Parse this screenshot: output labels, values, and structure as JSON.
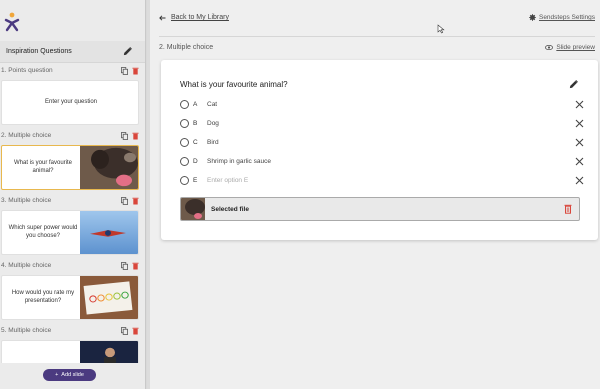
{
  "sidebar": {
    "title": "Inspiration Questions",
    "slides": [
      {
        "label": "1. Points question",
        "question": "Enter your question",
        "has_image": false
      },
      {
        "label": "2. Multiple choice",
        "question": "What is your favourite animal?",
        "has_image": true,
        "active": true
      },
      {
        "label": "3. Multiple choice",
        "question": "Which super power would you choose?",
        "has_image": true
      },
      {
        "label": "4. Multiple choice",
        "question": "How would you rate my presentation?",
        "has_image": true
      },
      {
        "label": "5. Multiple choice",
        "question": "",
        "has_image": true
      }
    ],
    "add_slide_label": "Add slide"
  },
  "topbar": {
    "back_label": "Back to My Library",
    "settings_label": "Sendsteps Settings"
  },
  "editor": {
    "slide_title": "2. Multiple choice",
    "preview_label": "Slide preview",
    "question": "What is your favourite animal?",
    "options": [
      {
        "letter": "A",
        "value": "Cat",
        "placeholder": false
      },
      {
        "letter": "B",
        "value": "Dog",
        "placeholder": false
      },
      {
        "letter": "C",
        "value": "Bird",
        "placeholder": false
      },
      {
        "letter": "D",
        "value": "Shrimp in garlic sauce",
        "placeholder": false
      },
      {
        "letter": "E",
        "value": "Enter option E",
        "placeholder": true
      }
    ],
    "file_label": "Selected file"
  },
  "colors": {
    "brand": "#4b3a80",
    "accent": "#e8b84e",
    "delete": "#d9463b"
  },
  "icons": {
    "logo": "sendsteps-logo",
    "edit": "pencil-icon",
    "copy": "copy-icon",
    "delete": "trash-icon",
    "back": "arrow-left-icon",
    "settings": "gear-icon",
    "preview": "eye-icon",
    "remove": "close-icon"
  }
}
